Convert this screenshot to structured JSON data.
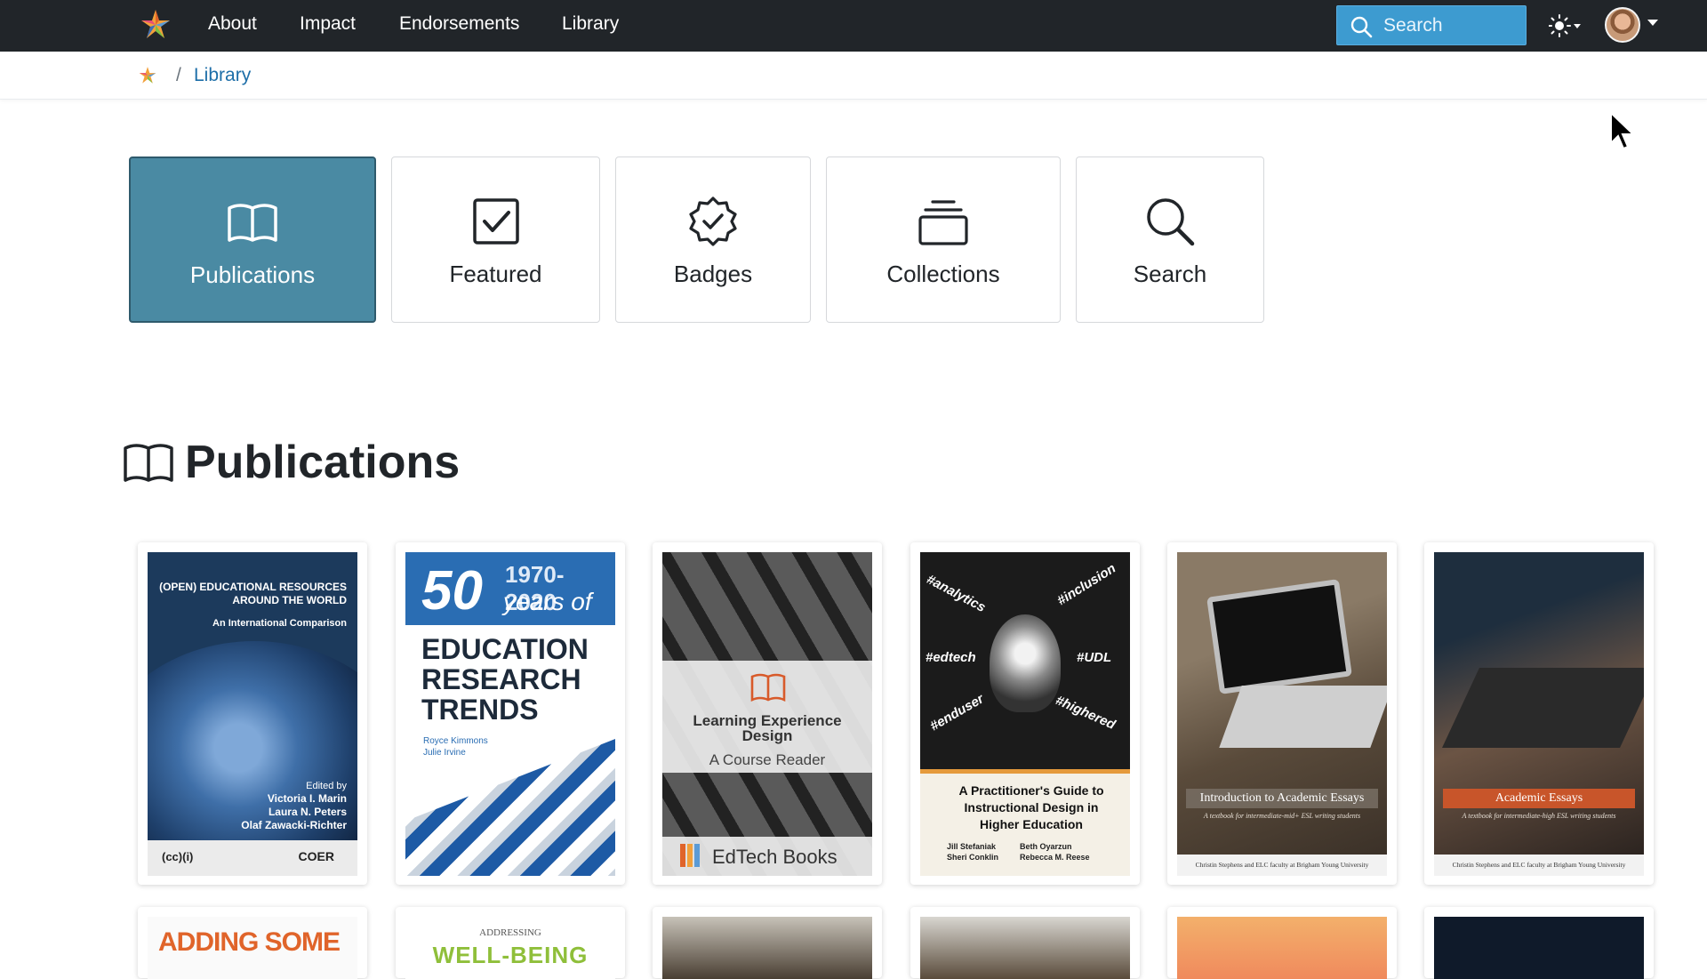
{
  "navbar": {
    "brand": "logo-icon",
    "links": [
      "About",
      "Impact",
      "Endorsements",
      "Library"
    ],
    "search_placeholder": "Search"
  },
  "breadcrumb": {
    "separator": "/",
    "current": "Library"
  },
  "tabs": [
    {
      "label": "Publications",
      "icon": "open-book-icon",
      "active": true
    },
    {
      "label": "Featured",
      "icon": "checkbox-icon",
      "active": false
    },
    {
      "label": "Badges",
      "icon": "badge-check-icon",
      "active": false
    },
    {
      "label": "Collections",
      "icon": "collection-stack-icon",
      "active": false
    },
    {
      "label": "Search",
      "icon": "magnifier-icon",
      "active": false
    }
  ],
  "section": {
    "title": "Publications"
  },
  "books": [
    {
      "title_lines": [
        "(OPEN) EDUCATIONAL RESOURCES",
        "AROUND THE WORLD"
      ],
      "subtitle": "An International Comparison",
      "edited_by": "Edited by",
      "editors": [
        "Victoria I. Marin",
        "Laura N. Peters",
        "Olaf Zawacki-Richter"
      ],
      "publisher": "COER"
    },
    {
      "big_number": "50",
      "years_range": "1970-2020",
      "years_of": "years of",
      "title_lines": [
        "EDUCATION",
        "RESEARCH",
        "TRENDS"
      ],
      "authors": [
        "Royce Kimmons",
        "Julie Irvine"
      ]
    },
    {
      "title_lines": [
        "Learning Experience",
        "Design"
      ],
      "subtitle": "A Course Reader",
      "publisher": "EdTech Books"
    },
    {
      "hashtags": [
        "#analytics",
        "#inclusion",
        "#edtech",
        "#UDL",
        "#enduser",
        "#highered"
      ],
      "title_lines": [
        "A Practitioner's Guide to",
        "Instructional Design in",
        "Higher Education"
      ],
      "authors_left": [
        "Jill Stefaniak",
        "Sheri Conklin"
      ],
      "authors_right": [
        "Beth Oyarzun",
        "Rebecca M. Reese"
      ]
    },
    {
      "title": "Introduction to Academic Essays",
      "subtitle": "A textbook for intermediate-mid+ ESL writing students",
      "credit": "Christin Stephens and ELC faculty at Brigham Young University"
    },
    {
      "title": "Academic Essays",
      "subtitle": "A textbook for intermediate-high ESL writing students",
      "credit": "Christin Stephens and ELC faculty at Brigham Young University"
    }
  ],
  "books_row2": [
    {
      "visible_text": "ADDING SOME"
    },
    {
      "small_text": "ADDRESSING",
      "big_text": "WELL-BEING"
    },
    {
      "visible_text": ""
    },
    {
      "visible_text": ""
    },
    {
      "visible_text": ""
    },
    {
      "visible_text": ""
    }
  ],
  "colors": {
    "navbar": "#212529",
    "search_box": "#3d9bd0",
    "active_tile": "#4a8aa3",
    "link": "#1d6ea8"
  }
}
